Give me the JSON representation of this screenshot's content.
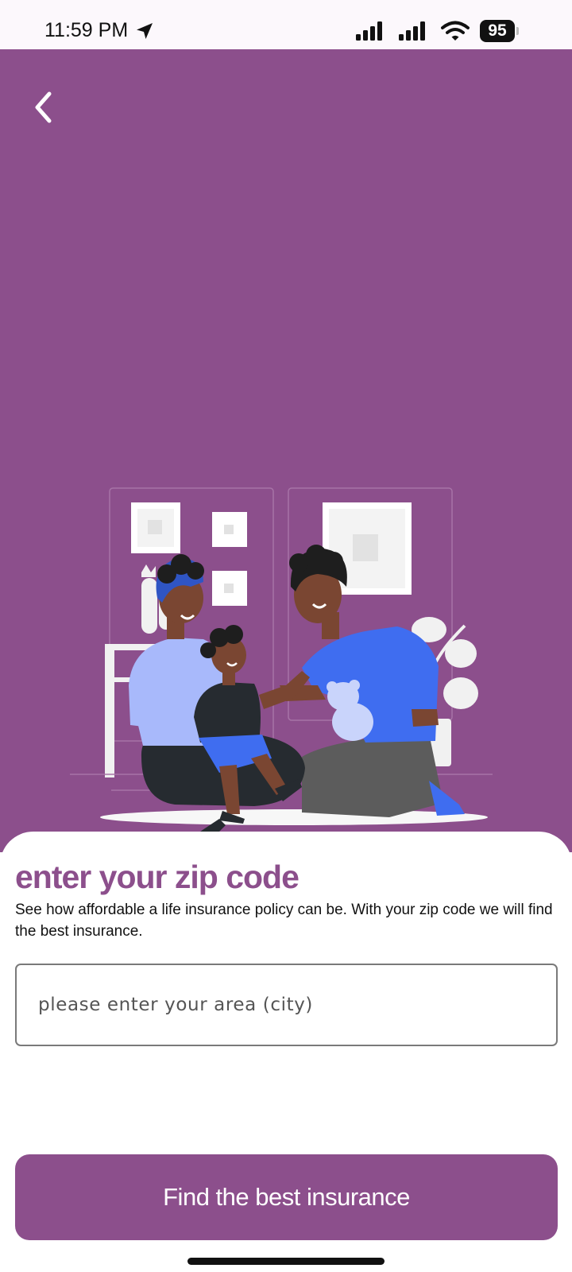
{
  "status_bar": {
    "time": "11:59 PM",
    "battery": "95",
    "icons": [
      "location-arrow-icon",
      "cellular-signal-icon",
      "cellular-signal-icon",
      "wifi-icon",
      "battery-icon"
    ]
  },
  "header": {
    "back_icon": "chevron-left-icon"
  },
  "colors": {
    "brand": "#8c4f8c",
    "sheet": "#ffffff",
    "text": "#111111",
    "shirt_blue": "#3f6df0"
  },
  "content": {
    "title": "enter your zip code",
    "description": "See how affordable a life insurance policy can be. With your zip code we will find the best insurance.",
    "input": {
      "value": "",
      "placeholder": "please enter your area (city)"
    },
    "cta_label": "Find the best insurance"
  }
}
